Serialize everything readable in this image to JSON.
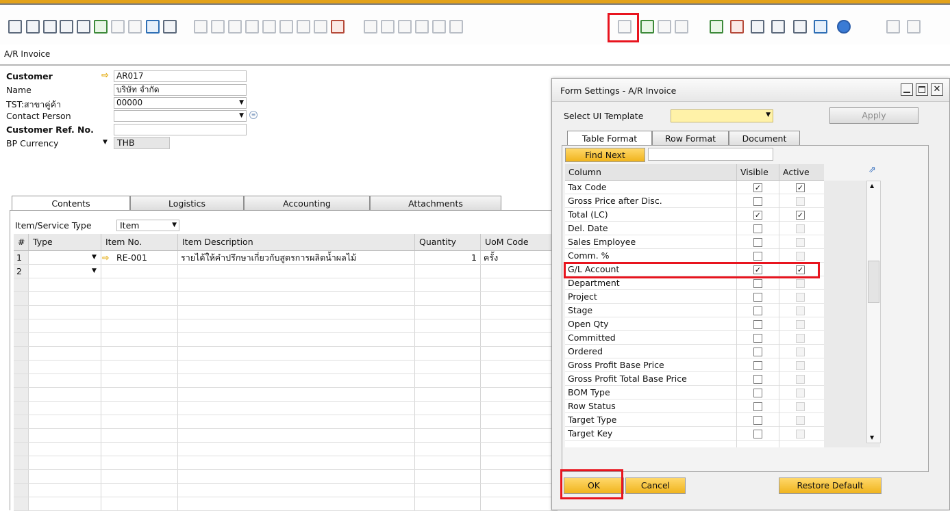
{
  "form": {
    "title": "A/R Invoice"
  },
  "toolbar": {
    "icons": [
      "preview-icon",
      "print-icon",
      "email-icon",
      "sms-icon",
      "fax-icon",
      "export-excel-icon",
      "export-word-icon",
      "export-pdf-icon",
      "launch-app-icon",
      "lock-screen-icon",
      "find-icon",
      "add-icon",
      "first-record-icon",
      "previous-record-icon",
      "next-record-icon",
      "last-record-icon",
      "refresh-icon",
      "filter-icon",
      "sort-icon",
      "base-document-icon",
      "target-document-icon",
      "document-drafts-icon",
      "gross-profit-icon",
      "payment-means-icon",
      "volume-weight-icon",
      "form-settings-icon",
      "settings-wizard-icon",
      "message-icon",
      "alert-icon",
      "calendar-icon",
      "query-icon",
      "report-icon",
      "user-defined-fields-icon",
      "user-icon",
      "web-icon",
      "help-icon",
      "layout-icon",
      "layout2-icon"
    ]
  },
  "header": {
    "customer_label": "Customer",
    "customer_value": "AR017",
    "name_label": "Name",
    "name_value": "บริษัท                จำกัด",
    "branch_label": "TST:สาขาคู่ค้า",
    "branch_value": "00000",
    "contact_label": "Contact Person",
    "contact_value": "",
    "refno_label": "Customer Ref. No.",
    "refno_value": "",
    "currency_label": "BP Currency",
    "currency_value": "THB"
  },
  "tabs": [
    "Contents",
    "Logistics",
    "Accounting",
    "Attachments"
  ],
  "contents": {
    "item_service_type_label": "Item/Service Type",
    "item_service_type_value": "Item",
    "columns": [
      "#",
      "Type",
      "Item No.",
      "Item Description",
      "Quantity",
      "UoM Code"
    ],
    "rows": [
      {
        "num": "1",
        "type": "",
        "item_no": "RE-001",
        "description": "รายได้ให้คำปรึกษาเกี่ยวกับสูตรการผลิตน้ำผลไม้",
        "quantity": "1",
        "uom": "ครั้ง"
      },
      {
        "num": "2",
        "type": "",
        "item_no": "",
        "description": "",
        "quantity": "",
        "uom": ""
      }
    ]
  },
  "dialog": {
    "title": "Form Settings - A/R Invoice",
    "select_template_label": "Select UI Template",
    "select_template_value": "",
    "apply_label": "Apply",
    "tabs": [
      "Table Format",
      "Row Format",
      "Document"
    ],
    "find_next_label": "Find Next",
    "find_value": "",
    "col_header": "Column",
    "visible_header": "Visible",
    "active_header": "Active",
    "columns": [
      {
        "name": "Tax Code",
        "visible": true,
        "active": true,
        "active_enabled": true
      },
      {
        "name": "Gross Price after Disc.",
        "visible": false,
        "active": false,
        "active_enabled": false
      },
      {
        "name": "Total (LC)",
        "visible": true,
        "active": true,
        "active_enabled": true
      },
      {
        "name": "Del. Date",
        "visible": false,
        "active": false,
        "active_enabled": false
      },
      {
        "name": "Sales Employee",
        "visible": false,
        "active": false,
        "active_enabled": false
      },
      {
        "name": "Comm. %",
        "visible": false,
        "active": false,
        "active_enabled": false
      },
      {
        "name": "G/L Account",
        "visible": true,
        "active": true,
        "active_enabled": true
      },
      {
        "name": "Department",
        "visible": false,
        "active": false,
        "active_enabled": false
      },
      {
        "name": "Project",
        "visible": false,
        "active": false,
        "active_enabled": false
      },
      {
        "name": "Stage",
        "visible": false,
        "active": false,
        "active_enabled": false
      },
      {
        "name": "Open Qty",
        "visible": false,
        "active": false,
        "active_enabled": false
      },
      {
        "name": "Committed",
        "visible": false,
        "active": false,
        "active_enabled": false
      },
      {
        "name": "Ordered",
        "visible": false,
        "active": false,
        "active_enabled": false
      },
      {
        "name": "Gross Profit Base Price",
        "visible": false,
        "active": false,
        "active_enabled": false
      },
      {
        "name": "Gross Profit Total Base Price",
        "visible": false,
        "active": false,
        "active_enabled": false
      },
      {
        "name": "BOM Type",
        "visible": false,
        "active": false,
        "active_enabled": false
      },
      {
        "name": "Row Status",
        "visible": false,
        "active": false,
        "active_enabled": false
      },
      {
        "name": "Target Type",
        "visible": false,
        "active": false,
        "active_enabled": false
      },
      {
        "name": "Target Key",
        "visible": false,
        "active": false,
        "active_enabled": false
      }
    ],
    "ok_label": "OK",
    "cancel_label": "Cancel",
    "restore_label": "Restore Default"
  },
  "colors": {
    "accent": "#e3a21a",
    "highlight": "#e8141e",
    "button": "#f0b41d"
  }
}
